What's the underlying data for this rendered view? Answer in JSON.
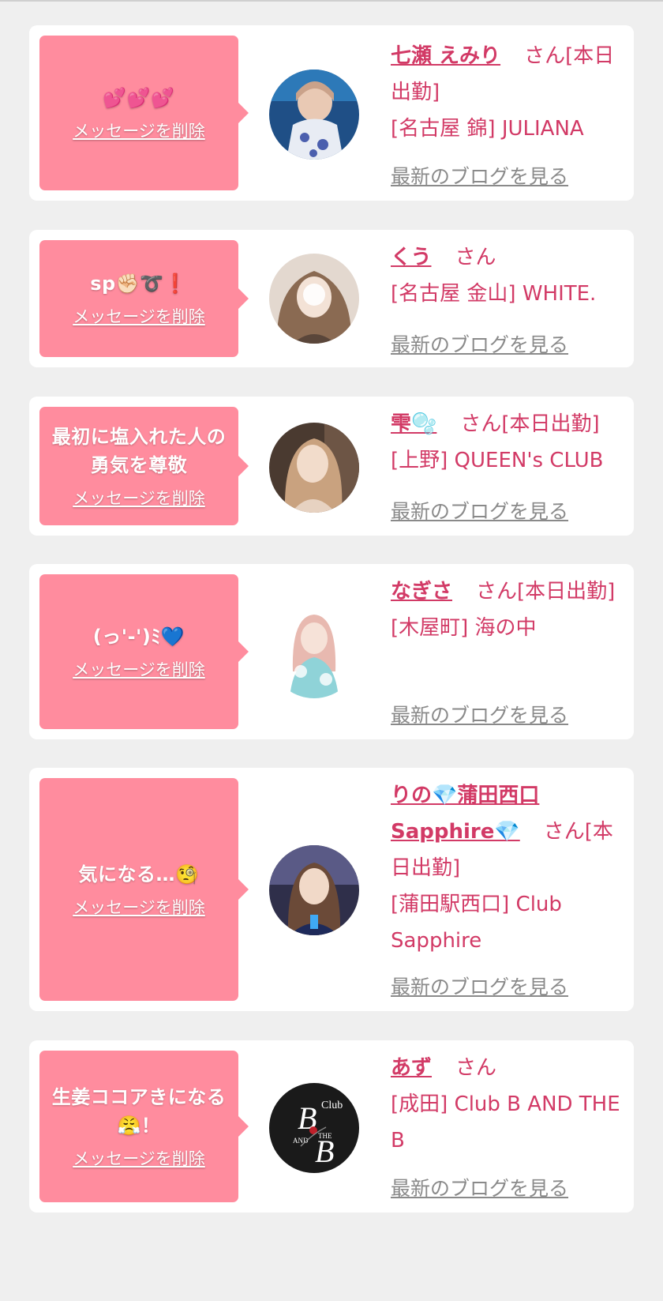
{
  "delete_label": "メッセージを削除",
  "blog_label": "最新のブログを見る",
  "cards": [
    {
      "message": "💕💕💕",
      "name": "七瀬 えみり",
      "suffix": "さん[本日出勤]",
      "shop": "[名古屋 錦] JULIANA"
    },
    {
      "message": "sp✊🏻➰❗",
      "name": "くう",
      "suffix": "さん",
      "shop": "[名古屋 金山] WHITE."
    },
    {
      "message": "最初に塩入れた人の勇気を尊敬",
      "name": "雫🫧",
      "suffix": "さん[本日出勤]",
      "shop": "[上野] QUEEN's CLUB"
    },
    {
      "message": "(っ'-')ﾐ💙",
      "name": "なぎさ",
      "suffix": "さん[本日出勤]",
      "shop": "[木屋町] 海の中"
    },
    {
      "message": "気になる…🧐",
      "name": "りの💎蒲田西口Sapphire💎",
      "suffix": "さん[本日出勤]",
      "shop": "[蒲田駅西口] Club Sapphire"
    },
    {
      "message": "生姜ココアきになる😤！",
      "name": "あず",
      "suffix": "さん",
      "shop": "[成田] Club B AND THE B",
      "avatar_text": "Club B AND THE B"
    }
  ]
}
